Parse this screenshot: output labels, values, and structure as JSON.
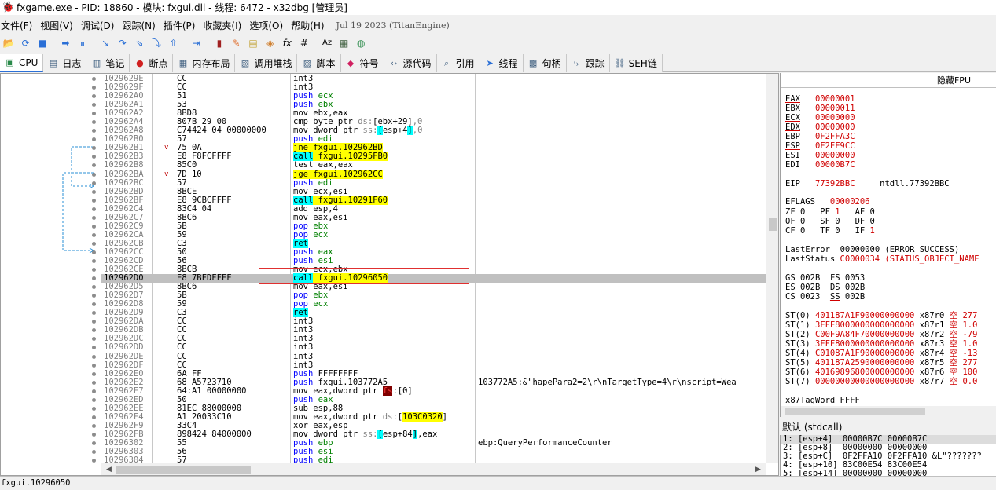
{
  "window": {
    "title": "fxgame.exe - PID: 18860 - 模块: fxgui.dll - 线程: 6472 - x32dbg [管理员]"
  },
  "menu": {
    "items": [
      "文件(F)",
      "视图(V)",
      "调试(D)",
      "跟踪(N)",
      "插件(P)",
      "收藏夹(I)",
      "选项(O)",
      "帮助(H)"
    ],
    "build_date": "Jul 19 2023 (TitanEngine)"
  },
  "toolbar": {
    "icons": [
      "open-icon",
      "restart-icon",
      "stop-icon",
      "run-icon",
      "pause-icon",
      "step-into-icon",
      "step-over-icon",
      "trace-into-icon",
      "trace-over-icon",
      "execute-till-return-icon",
      "run-to-user-code-icon",
      "patch-icon",
      "comment-icon",
      "label-icon",
      "bookmark-icon",
      "function-icon",
      "hash-icon",
      "strings-icon",
      "calculator-icon",
      "globe-icon"
    ],
    "fx_label": "fx",
    "hash_label": "#",
    "strings_label": "Az"
  },
  "tabs": [
    {
      "label": "CPU",
      "icon": "cpu-icon",
      "active": true
    },
    {
      "label": "日志",
      "icon": "log-icon"
    },
    {
      "label": "笔记",
      "icon": "notes-icon"
    },
    {
      "label": "断点",
      "icon": "breakpoint-icon"
    },
    {
      "label": "内存布局",
      "icon": "memory-map-icon"
    },
    {
      "label": "调用堆栈",
      "icon": "call-stack-icon"
    },
    {
      "label": "脚本",
      "icon": "script-icon"
    },
    {
      "label": "符号",
      "icon": "symbols-icon"
    },
    {
      "label": "源代码",
      "icon": "source-icon"
    },
    {
      "label": "引用",
      "icon": "references-icon"
    },
    {
      "label": "线程",
      "icon": "threads-icon"
    },
    {
      "label": "句柄",
      "icon": "handles-icon"
    },
    {
      "label": "跟踪",
      "icon": "trace-icon"
    },
    {
      "label": "SEH链",
      "icon": "seh-icon"
    }
  ],
  "disasm": {
    "rows": [
      {
        "addr": "1029629E",
        "bytes": "CC",
        "ins": [
          [
            "int3",
            "mn"
          ]
        ]
      },
      {
        "addr": "1029629F",
        "bytes": "CC",
        "ins": [
          [
            "int3",
            "mn"
          ]
        ]
      },
      {
        "addr": "102962A0",
        "bytes": "51",
        "ins": [
          [
            "push ",
            "blue"
          ],
          [
            "ecx",
            "reg"
          ]
        ]
      },
      {
        "addr": "102962A1",
        "bytes": "53",
        "ins": [
          [
            "push ",
            "blue"
          ],
          [
            "ebx",
            "reg"
          ]
        ]
      },
      {
        "addr": "102962A2",
        "bytes": "8BD8",
        "ins": [
          [
            "mov ebx,eax",
            "mn"
          ]
        ]
      },
      {
        "addr": "102962A4",
        "bytes": "807B 29 00",
        "ins": [
          [
            "cmp byte ptr ",
            "mn"
          ],
          [
            "ds:",
            "num"
          ],
          [
            "[ebx+29]",
            "mn"
          ],
          [
            ",0",
            "num"
          ]
        ]
      },
      {
        "addr": "102962A8",
        "bytes": "C74424 04 00000000",
        "ins": [
          [
            "mov dword ptr ",
            "mn"
          ],
          [
            "ss:",
            "num"
          ],
          [
            "[",
            "hc"
          ],
          [
            "esp+4",
            "mn"
          ],
          [
            "]",
            "hc"
          ],
          [
            ",0",
            "num"
          ]
        ]
      },
      {
        "addr": "102962B0",
        "bytes": "57",
        "ins": [
          [
            "push ",
            "blue"
          ],
          [
            "edi",
            "reg"
          ]
        ]
      },
      {
        "addr": "102962B1",
        "bytes": "75 0A",
        "jmp": "v",
        "ins": [
          [
            "jne fxgui.102962BD",
            "hy"
          ]
        ]
      },
      {
        "addr": "102962B3",
        "bytes": "E8 F8FCFFFF",
        "ins": [
          [
            "call",
            "hc"
          ],
          [
            " fxgui.10295FB0",
            "hy"
          ]
        ]
      },
      {
        "addr": "102962B8",
        "bytes": "85C0",
        "ins": [
          [
            "test eax,eax",
            "mn"
          ]
        ]
      },
      {
        "addr": "102962BA",
        "bytes": "7D 10",
        "jmp": "v",
        "ins": [
          [
            "jge fxgui.102962CC",
            "hy"
          ]
        ]
      },
      {
        "addr": "102962BC",
        "bytes": "57",
        "ins": [
          [
            "push ",
            "blue"
          ],
          [
            "edi",
            "reg"
          ]
        ]
      },
      {
        "addr": "102962BD",
        "bytes": "8BCE",
        "ins": [
          [
            "mov ecx,esi",
            "mn"
          ]
        ]
      },
      {
        "addr": "102962BF",
        "bytes": "E8 9CBCFFFF",
        "ins": [
          [
            "call",
            "hc"
          ],
          [
            " fxgui.10291F60",
            "hy"
          ]
        ]
      },
      {
        "addr": "102962C4",
        "bytes": "83C4 04",
        "ins": [
          [
            "add esp,4",
            "mn"
          ]
        ]
      },
      {
        "addr": "102962C7",
        "bytes": "8BC6",
        "ins": [
          [
            "mov eax,esi",
            "mn"
          ]
        ]
      },
      {
        "addr": "102962C9",
        "bytes": "5B",
        "ins": [
          [
            "pop ",
            "blue"
          ],
          [
            "ebx",
            "reg"
          ]
        ]
      },
      {
        "addr": "102962CA",
        "bytes": "59",
        "ins": [
          [
            "pop ",
            "blue"
          ],
          [
            "ecx",
            "reg"
          ]
        ]
      },
      {
        "addr": "102962CB",
        "bytes": "C3",
        "ins": [
          [
            "ret",
            "hc"
          ]
        ]
      },
      {
        "addr": "102962CC",
        "bytes": "50",
        "ins": [
          [
            "push ",
            "blue"
          ],
          [
            "eax",
            "reg"
          ]
        ]
      },
      {
        "addr": "102962CD",
        "bytes": "56",
        "ins": [
          [
            "push ",
            "blue"
          ],
          [
            "esi",
            "reg"
          ]
        ]
      },
      {
        "addr": "102962CE",
        "bytes": "8BCB",
        "ins": [
          [
            "mov ecx,ebx",
            "mn"
          ]
        ]
      },
      {
        "addr": "102962D0",
        "bytes": "E8 7BFDFFFF",
        "sel": true,
        "ins": [
          [
            "call",
            "hc"
          ],
          [
            " fxgui.10296050",
            "hy"
          ]
        ]
      },
      {
        "addr": "102962D5",
        "bytes": "8BC6",
        "ins": [
          [
            "mov eax,esi",
            "mn"
          ]
        ]
      },
      {
        "addr": "102962D7",
        "bytes": "5B",
        "ins": [
          [
            "pop ",
            "blue"
          ],
          [
            "ebx",
            "reg"
          ]
        ]
      },
      {
        "addr": "102962D8",
        "bytes": "59",
        "ins": [
          [
            "pop ",
            "blue"
          ],
          [
            "ecx",
            "reg"
          ]
        ]
      },
      {
        "addr": "102962D9",
        "bytes": "C3",
        "ins": [
          [
            "ret",
            "hc"
          ]
        ]
      },
      {
        "addr": "102962DA",
        "bytes": "CC",
        "ins": [
          [
            "int3",
            "mn"
          ]
        ]
      },
      {
        "addr": "102962DB",
        "bytes": "CC",
        "ins": [
          [
            "int3",
            "mn"
          ]
        ]
      },
      {
        "addr": "102962DC",
        "bytes": "CC",
        "ins": [
          [
            "int3",
            "mn"
          ]
        ]
      },
      {
        "addr": "102962DD",
        "bytes": "CC",
        "ins": [
          [
            "int3",
            "mn"
          ]
        ]
      },
      {
        "addr": "102962DE",
        "bytes": "CC",
        "ins": [
          [
            "int3",
            "mn"
          ]
        ]
      },
      {
        "addr": "102962DF",
        "bytes": "CC",
        "ins": [
          [
            "int3",
            "mn"
          ]
        ]
      },
      {
        "addr": "102962E0",
        "bytes": "6A FF",
        "ins": [
          [
            "push ",
            "blue"
          ],
          [
            "FFFFFFFF",
            "mn"
          ]
        ]
      },
      {
        "addr": "102962E2",
        "bytes": "68 A5723710",
        "ins": [
          [
            "push ",
            "blue"
          ],
          [
            "fxgui.103772A5",
            "mn"
          ]
        ],
        "cmt": "103772A5:&\"hapePara2=2\\r\\nTargetType=4\\r\\nscript=Wea"
      },
      {
        "addr": "102962E7",
        "bytes": "64:A1 00000000",
        "ins": [
          [
            "mov eax,dword ptr ",
            "mn"
          ],
          [
            "fs",
            "hr"
          ],
          [
            ":[0]",
            "mn"
          ]
        ]
      },
      {
        "addr": "102962ED",
        "bytes": "50",
        "ins": [
          [
            "push ",
            "blue"
          ],
          [
            "eax",
            "reg"
          ]
        ]
      },
      {
        "addr": "102962EE",
        "bytes": "81EC 88000000",
        "ins": [
          [
            "sub esp,88",
            "mn"
          ]
        ]
      },
      {
        "addr": "102962F4",
        "bytes": "A1 20033C10",
        "ins": [
          [
            "mov eax,dword ptr ",
            "mn"
          ],
          [
            "ds:",
            "num"
          ],
          [
            "[",
            "mn"
          ],
          [
            "103C0320",
            "hy"
          ],
          [
            "]",
            "mn"
          ]
        ]
      },
      {
        "addr": "102962F9",
        "bytes": "33C4",
        "ins": [
          [
            "xor eax,esp",
            "mn"
          ]
        ]
      },
      {
        "addr": "102962FB",
        "bytes": "898424 84000000",
        "ins": [
          [
            "mov dword ptr ",
            "mn"
          ],
          [
            "ss:",
            "num"
          ],
          [
            "[",
            "hc"
          ],
          [
            "esp+84",
            "mn"
          ],
          [
            "]",
            "hc"
          ],
          [
            ",eax",
            "mn"
          ]
        ]
      },
      {
        "addr": "10296302",
        "bytes": "55",
        "ins": [
          [
            "push ",
            "blue"
          ],
          [
            "ebp",
            "reg"
          ]
        ],
        "cmt": "ebp:QueryPerformanceCounter"
      },
      {
        "addr": "10296303",
        "bytes": "56",
        "ins": [
          [
            "push ",
            "blue"
          ],
          [
            "esi",
            "reg"
          ]
        ]
      },
      {
        "addr": "10296304",
        "bytes": "57",
        "ins": [
          [
            "push ",
            "blue"
          ],
          [
            "edi",
            "reg"
          ]
        ]
      }
    ]
  },
  "registers": {
    "header": "隐藏FPU",
    "gpr": [
      {
        "name": "EAX",
        "value": "00000001",
        "changed": true
      },
      {
        "name": "EBX",
        "value": "00000011",
        "changed": false
      },
      {
        "name": "ECX",
        "value": "00000000",
        "changed": true
      },
      {
        "name": "EDX",
        "value": "00000000",
        "changed": true
      },
      {
        "name": "EBP",
        "value": "0F2FFA3C",
        "changed": false
      },
      {
        "name": "ESP",
        "value": "0F2FF9CC",
        "changed": true
      },
      {
        "name": "ESI",
        "value": "00000000",
        "changed": false
      },
      {
        "name": "EDI",
        "value": "00000B7C",
        "changed": false
      }
    ],
    "eip": {
      "name": "EIP",
      "value": "77392BBC",
      "label": "ntdll.77392BBC"
    },
    "eflags": {
      "name": "EFLAGS",
      "value": "00000206"
    },
    "flags": [
      [
        {
          "n": "ZF",
          "v": "0"
        },
        {
          "n": "PF",
          "v": "1"
        },
        {
          "n": "AF",
          "v": "0"
        }
      ],
      [
        {
          "n": "OF",
          "v": "0"
        },
        {
          "n": "SF",
          "v": "0"
        },
        {
          "n": "DF",
          "v": "0"
        }
      ],
      [
        {
          "n": "CF",
          "v": "0"
        },
        {
          "n": "TF",
          "v": "0"
        },
        {
          "n": "IF",
          "v": "1"
        }
      ]
    ],
    "last_error": {
      "name": "LastError",
      "value": "00000000",
      "desc": "(ERROR_SUCCESS)"
    },
    "last_status": {
      "name": "LastStatus",
      "value": "C0000034",
      "desc": "(STATUS_OBJECT_NAME"
    },
    "segs": [
      [
        {
          "n": "GS",
          "v": "002B"
        },
        {
          "n": "FS",
          "v": "0053"
        }
      ],
      [
        {
          "n": "ES",
          "v": "002B"
        },
        {
          "n": "DS",
          "v": "002B"
        }
      ],
      [
        {
          "n": "CS",
          "v": "0023"
        },
        {
          "n": "SS",
          "v": "002B"
        }
      ]
    ],
    "st": [
      {
        "n": "ST(0)",
        "v": "401187A1F90000000000",
        "x": "x87r0",
        "s": "空",
        "f": "277"
      },
      {
        "n": "ST(1)",
        "v": "3FFF8000000000000000",
        "x": "x87r1",
        "s": "空",
        "f": "1.0"
      },
      {
        "n": "ST(2)",
        "v": "C00F9A84F70000000000",
        "x": "x87r2",
        "s": "空",
        "f": "-79"
      },
      {
        "n": "ST(3)",
        "v": "3FFF8000000000000000",
        "x": "x87r3",
        "s": "空",
        "f": "1.0"
      },
      {
        "n": "ST(4)",
        "v": "C01087A1F90000000000",
        "x": "x87r4",
        "s": "空",
        "f": "-13"
      },
      {
        "n": "ST(5)",
        "v": "401187A2590000000000",
        "x": "x87r5",
        "s": "空",
        "f": "277"
      },
      {
        "n": "ST(6)",
        "v": "40169896800000000000",
        "x": "x87r6",
        "s": "空",
        "f": "100"
      },
      {
        "n": "ST(7)",
        "v": "00000000000000000000",
        "x": "x87r7",
        "s": "空",
        "f": "0.0"
      }
    ],
    "tagword": {
      "name": "x87TagWord",
      "value": "FFFF"
    }
  },
  "stack": {
    "header": "默认 (stdcall)",
    "lines": [
      "1: [esp+4]  00000B7C 00000B7C",
      "2: [esp+8]  00000000 00000000",
      "3: [esp+C]  0F2FFA10 0F2FFA10 &L\"???????",
      "4: [esp+10] 83C00E54 83C00E54",
      "5: [esp+14] 00000000 00000000"
    ]
  },
  "status": {
    "text": "fxgui.10296050"
  }
}
